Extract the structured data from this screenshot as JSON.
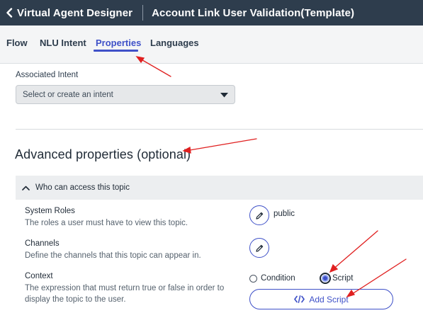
{
  "header": {
    "app_title": "Virtual Agent Designer",
    "page_title": "Account Link User Validation(Template)",
    "back_icon": "chevron-left-icon"
  },
  "tabs": [
    {
      "label": "Flow",
      "active": false
    },
    {
      "label": "NLU Intent",
      "active": false
    },
    {
      "label": "Properties",
      "active": true
    },
    {
      "label": "Languages",
      "active": false
    }
  ],
  "intent": {
    "label": "Associated Intent",
    "placeholder": "Select or create an intent",
    "caret_icon": "caret-down-icon"
  },
  "advanced": {
    "title": "Advanced properties (optional)",
    "accordion_title": "Who can access this topic",
    "accordion_icon": "chevron-up-icon",
    "system_roles": {
      "title": "System Roles",
      "description": "The roles a user must have to view this topic.",
      "value": "public"
    },
    "channels": {
      "title": "Channels",
      "description": "Define the channels that this topic can appear in."
    },
    "context": {
      "title": "Context",
      "description": "The expression that must return true or false in order to display the topic to the user.",
      "options": [
        {
          "label": "Condition",
          "selected": false
        },
        {
          "label": "Script",
          "selected": true
        }
      ],
      "add_script_label": "Add Script",
      "add_script_icon": "code-icon"
    }
  },
  "colors": {
    "header_bg": "#2e3d4d",
    "accent": "#3f51c8",
    "annotation": "#e02020"
  }
}
